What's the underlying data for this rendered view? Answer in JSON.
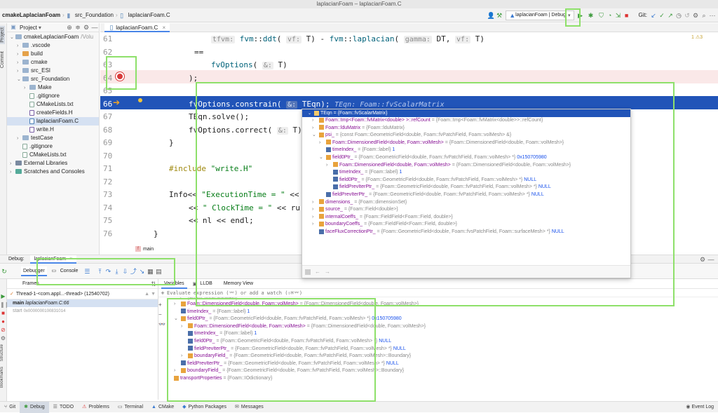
{
  "window_title": "laplacianFoam – laplacianFoam.C",
  "breadcrumb": [
    "cmakeLaplacianFoam",
    "src_Foundation",
    "laplacianFoam.C"
  ],
  "run_config": "laplacianFoam | Debug",
  "git_label": "Git:",
  "project_panel": {
    "title": "Project",
    "tree": [
      {
        "label": "cmakeLaplacianFoam",
        "suffix": "/Volu",
        "depth": 0,
        "kind": "folder",
        "open": true
      },
      {
        "label": ".vscode",
        "depth": 1,
        "kind": "folder"
      },
      {
        "label": "build",
        "depth": 1,
        "kind": "folder-orange"
      },
      {
        "label": "cmake",
        "depth": 1,
        "kind": "folder"
      },
      {
        "label": "src_ESI",
        "depth": 1,
        "kind": "folder"
      },
      {
        "label": "src_Foundation",
        "depth": 1,
        "kind": "folder",
        "open": true
      },
      {
        "label": "Make",
        "depth": 2,
        "kind": "folder"
      },
      {
        "label": ".gitignore",
        "depth": 2,
        "kind": "file"
      },
      {
        "label": "CMakeLists.txt",
        "depth": 2,
        "kind": "file"
      },
      {
        "label": "createFields.H",
        "depth": 2,
        "kind": "file-h"
      },
      {
        "label": "laplacianFoam.C",
        "depth": 2,
        "kind": "file-c",
        "selected": true
      },
      {
        "label": "write.H",
        "depth": 2,
        "kind": "file-h"
      },
      {
        "label": "testCase",
        "depth": 1,
        "kind": "folder"
      },
      {
        "label": ".gitignore",
        "depth": 1,
        "kind": "file"
      },
      {
        "label": "CMakeLists.txt",
        "depth": 1,
        "kind": "file"
      },
      {
        "label": "External Libraries",
        "depth": 0,
        "kind": "lib"
      },
      {
        "label": "Scratches and Consoles",
        "depth": 0,
        "kind": "scratch"
      }
    ],
    "side_tabs": [
      "Project",
      "Commit"
    ]
  },
  "editor": {
    "tab": "laplacianFoam.C",
    "line_numbers": [
      "61",
      "62",
      "63",
      "64",
      "65",
      "66",
      "67",
      "68",
      "69",
      "70",
      "71",
      "72",
      "73",
      "74",
      "75",
      "76"
    ],
    "inspection": "1 ⚠3",
    "breadcrumb_footer": "main",
    "inline_type": "TEqn: Foam::fvScalarMatrix"
  },
  "popup": {
    "header": "TEqn = {Foam::fvScalarMatrix}",
    "items": [
      {
        "d": 0,
        "ic": "f",
        "ar": "›",
        "nm": "Foam::tmp<Foam::fvMatrix<double> >::refCount",
        "tp": " = {Foam::tmp<Foam::fvMatrix<double>>::refCount}"
      },
      {
        "d": 0,
        "ic": "f",
        "ar": "›",
        "nm": "Foam::lduMatrix",
        "tp": " = {Foam::lduMatrix}"
      },
      {
        "d": 0,
        "ic": "f",
        "ar": "⌄",
        "nm": "psi_",
        "tp": " = {const Foam::GeometricField<double, Foam::fvPatchField, Foam::volMesh> &}"
      },
      {
        "d": 1,
        "ic": "f",
        "ar": "›",
        "nm": "Foam::DimensionedField<double, Foam::volMesh>",
        "tp": " = {Foam::DimensionedField<double, Foam::volMesh>}"
      },
      {
        "d": 1,
        "ic": "m",
        "ar": "",
        "nm": "timeIndex_",
        "tp": " = {Foam::label}",
        "vl": " 1"
      },
      {
        "d": 1,
        "ic": "f",
        "ar": "⌄",
        "nm": "field0Ptr_",
        "tp": " = {Foam::GeometricField<double, Foam::fvPatchField, Foam::volMesh> *}",
        "vl": " 0x150705980"
      },
      {
        "d": 2,
        "ic": "f",
        "ar": "›",
        "nm": "Foam::DimensionedField<double, Foam::volMesh>",
        "tp": " = {Foam::DimensionedField<double, Foam::volMesh>}"
      },
      {
        "d": 2,
        "ic": "m",
        "ar": "",
        "nm": "timeIndex_",
        "tp": " = {Foam::label}",
        "vl": " 1"
      },
      {
        "d": 2,
        "ic": "m",
        "ar": "",
        "nm": "field0Ptr_",
        "tp": " = {Foam::GeometricField<double, Foam::fvPatchField, Foam::volMesh> *}",
        "vl": " NULL"
      },
      {
        "d": 2,
        "ic": "m",
        "ar": "",
        "nm": "fieldPrevIterPtr_",
        "tp": " = {Foam::GeometricField<double, Foam::fvPatchField, Foam::volMesh> *}",
        "vl": " NULL"
      },
      {
        "d": 1,
        "ic": "m",
        "ar": "",
        "nm": "fieldPrevIterPtr_",
        "tp": " = {Foam::GeometricField<double, Foam::fvPatchField, Foam::volMesh> *}",
        "vl": " NULL"
      },
      {
        "d": 0,
        "ic": "f",
        "ar": "›",
        "nm": "dimensions_",
        "tp": " = {Foam::dimensionSet}"
      },
      {
        "d": 0,
        "ic": "f",
        "ar": "›",
        "nm": "source_",
        "tp": " = {Foam::Field<double>}"
      },
      {
        "d": 0,
        "ic": "f",
        "ar": "›",
        "nm": "internalCoeffs_",
        "tp": " = {Foam::FieldField<Foam::Field, double>}"
      },
      {
        "d": 0,
        "ic": "f",
        "ar": "›",
        "nm": "boundaryCoeffs_",
        "tp": " = {Foam::FieldField<Foam::Field, double>}"
      },
      {
        "d": 0,
        "ic": "m",
        "ar": "",
        "nm": "faceFluxCorrectionPtr_",
        "tp": " = {Foam::GeometricField<double, Foam::fvsPatchField, Foam::surfaceMesh> *}",
        "vl": " NULL"
      }
    ]
  },
  "debug": {
    "label": "Debug:",
    "session": "laplacianFoam",
    "tabs": [
      "Debugger",
      "Console"
    ],
    "frames_title": "Frames",
    "thread": "Thread-1-<com.appl...-thread> (12540702)",
    "frames": [
      {
        "name": "main",
        "detail": "laplacianFoam.C:66"
      },
      {
        "name": "start",
        "detail": "0x0000000100831014"
      }
    ],
    "var_tabs": [
      "Variables",
      "LLDB",
      "Memory View"
    ],
    "eval_placeholder": "Evaluate expression (⌤) or add a watch (⇧⌘⌤)",
    "vars": [
      {
        "d": 1,
        "ic": "f",
        "ar": "›",
        "nm": "Foam::DimensionedField<double, Foam::volMesh>",
        "tp": " = {Foam::DimensionedField<double, Foam::volMesh>}"
      },
      {
        "d": 1,
        "ic": "m",
        "ar": "",
        "nm": "timeIndex_",
        "tp": " = {Foam::label}",
        "vl": " 1"
      },
      {
        "d": 1,
        "ic": "f",
        "ar": "⌄",
        "nm": "field0Ptr_",
        "tp": " = {Foam::GeometricField<double, Foam::fvPatchField, Foam::volMesh> *}",
        "vl": " 0x150705980"
      },
      {
        "d": 2,
        "ic": "f",
        "ar": "›",
        "nm": "Foam::DimensionedField<double, Foam::volMesh>",
        "tp": " = {Foam::DimensionedField<double, Foam::volMesh>}"
      },
      {
        "d": 2,
        "ic": "m",
        "ar": "",
        "nm": "timeIndex_",
        "tp": " = {Foam::label}",
        "vl": " 1"
      },
      {
        "d": 2,
        "ic": "m",
        "ar": "",
        "nm": "field0Ptr_",
        "tp": " = {Foam::GeometricField<double, Foam::fvPatchField, Foam::volMesh> *}",
        "vl": " NULL"
      },
      {
        "d": 2,
        "ic": "m",
        "ar": "",
        "nm": "fieldPrevIterPtr_",
        "tp": " = {Foam::GeometricField<double, Foam::fvPatchField, Foam::volMesh> *}",
        "vl": " NULL"
      },
      {
        "d": 2,
        "ic": "f",
        "ar": "›",
        "nm": "boundaryField_",
        "tp": " = {Foam::GeometricField<double, Foam::fvPatchField, Foam::volMesh>::Boundary}"
      },
      {
        "d": 1,
        "ic": "m",
        "ar": "",
        "nm": "fieldPrevIterPtr_",
        "tp": " = {Foam::GeometricField<double, Foam::fvPatchField, Foam::volMesh> *}",
        "vl": " NULL"
      },
      {
        "d": 1,
        "ic": "f",
        "ar": "›",
        "nm": "boundaryField_",
        "tp": " = {Foam::GeometricField<double, Foam::fvPatchField, Foam::volMesh>::Boundary}"
      },
      {
        "d": 0,
        "ic": "f",
        "ar": "›",
        "nm": "transportProperties",
        "tp": " = {Foam::IOdictionary}"
      }
    ]
  },
  "bottom_tabs": [
    "Git",
    "Debug",
    "TODO",
    "Problems",
    "Terminal",
    "CMake",
    "Python Packages",
    "Messages"
  ],
  "event_log": "Event Log",
  "side_tabs_bottom": [
    "Structure",
    "Bookmarks"
  ]
}
